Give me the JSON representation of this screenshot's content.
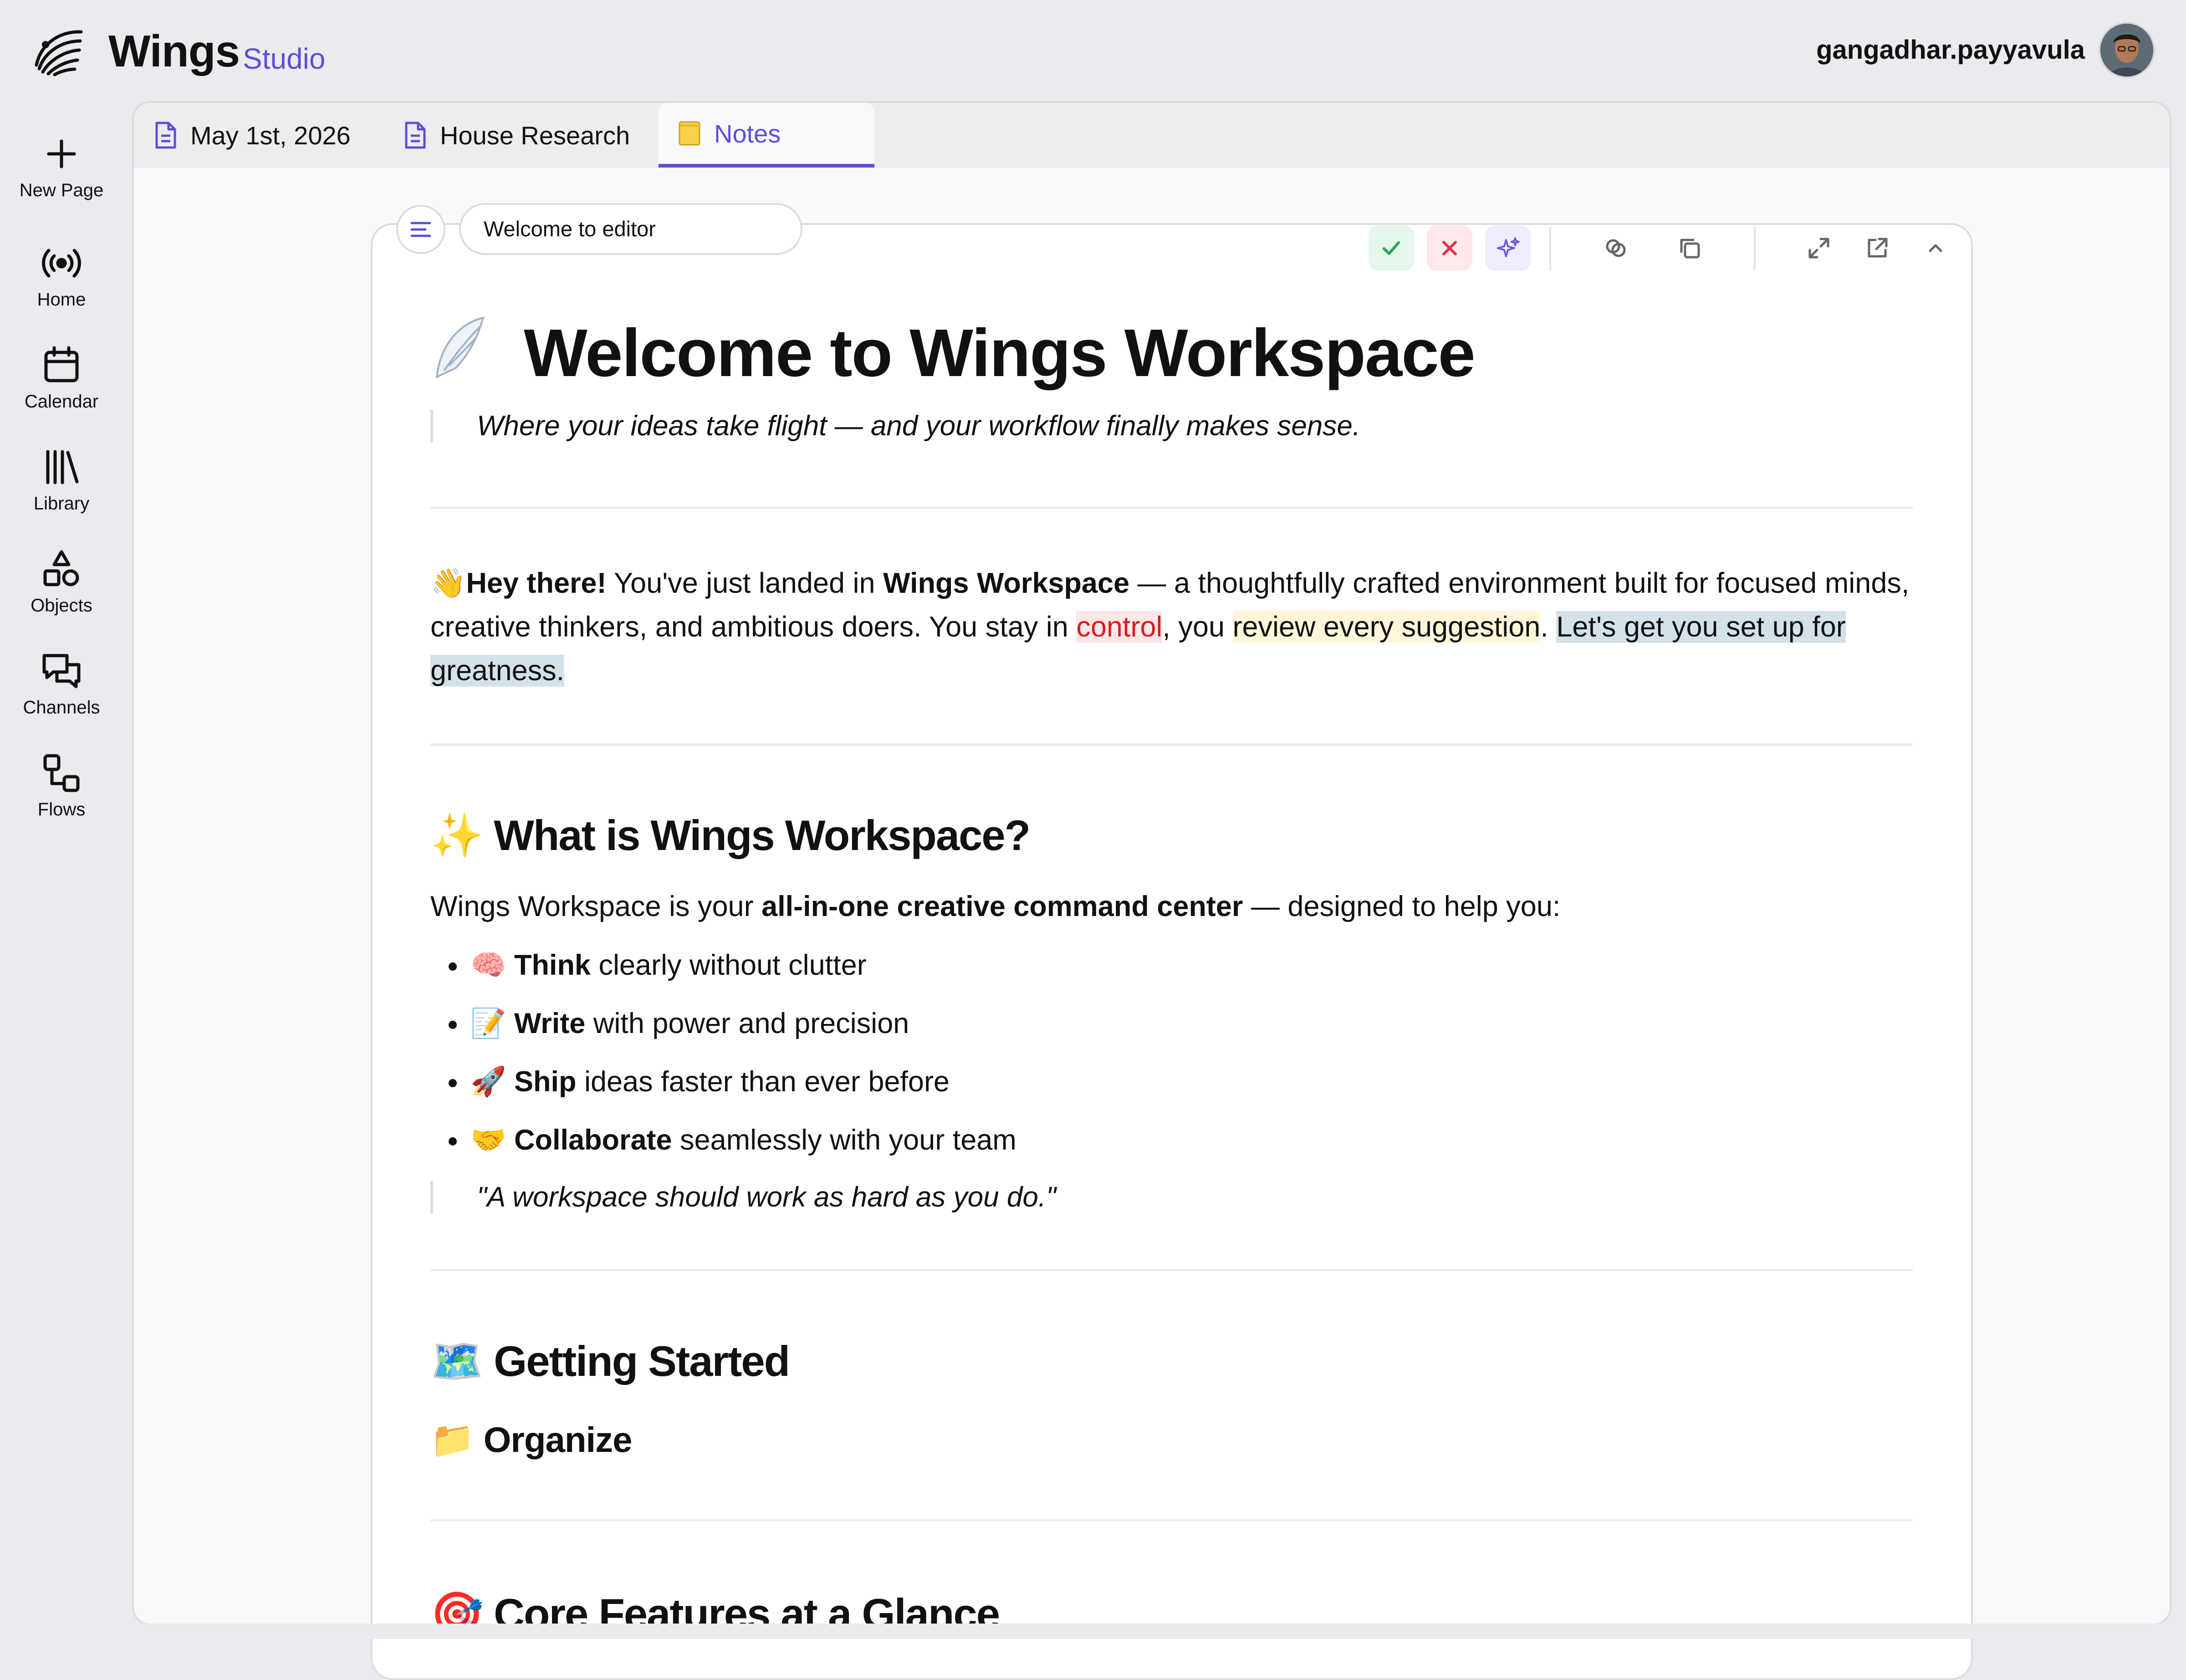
{
  "app": {
    "title": "Wings",
    "subtitle": "Studio"
  },
  "user": {
    "name": "gangadhar.payyavula"
  },
  "sidebar": {
    "items": [
      {
        "label": "New Page",
        "icon": "plus-icon"
      },
      {
        "label": "Home",
        "icon": "broadcast-icon"
      },
      {
        "label": "Calendar",
        "icon": "calendar-icon"
      },
      {
        "label": "Library",
        "icon": "library-icon"
      },
      {
        "label": "Objects",
        "icon": "shapes-icon"
      },
      {
        "label": "Channels",
        "icon": "chat-icon"
      },
      {
        "label": "Flows",
        "icon": "flow-icon"
      }
    ]
  },
  "tabs": [
    {
      "label": "May 1st, 2026",
      "icon": "document-icon"
    },
    {
      "label": "House Research",
      "icon": "document-icon"
    },
    {
      "label": "Notes",
      "icon": "notepad-emoji",
      "active": true
    }
  ],
  "editor": {
    "title_input": "Welcome to editor",
    "toolbar": [
      "accept-icon",
      "reject-icon",
      "ai-sparkle-icon",
      "link-icon",
      "copy-icon",
      "expand-icon",
      "open-external-icon",
      "collapse-icon"
    ]
  },
  "doc": {
    "title": "Welcome to Wings Workspace",
    "title_emoji": "🪽",
    "tagline": "Where your ideas take flight — and your workflow finally makes sense.",
    "intro": {
      "emoji": "👋",
      "bold1": "Hey there!",
      "t1": " You've just landed in ",
      "bold2": "Wings Workspace",
      "t2": " — a thoughtfully crafted environment built for focused minds, creative thinkers, and ambitious doers. You stay in ",
      "red": "control",
      "t3": ", you ",
      "yellow": "review every suggestion",
      "t4": ". ",
      "blue": "Let's get you set up for greatness."
    },
    "section1": {
      "emoji": "✨",
      "heading": "What is Wings Workspace?",
      "lead_t1": "Wings Workspace is your ",
      "lead_bold": "all-in-one creative command center",
      "lead_t2": " — designed to help you:",
      "bullets": [
        {
          "emoji": "🧠",
          "bold": "Think",
          "text": " clearly without clutter"
        },
        {
          "emoji": "📝",
          "bold": "Write",
          "text": " with power and precision"
        },
        {
          "emoji": "🚀",
          "bold": "Ship",
          "text": " ideas faster than ever before"
        },
        {
          "emoji": "🤝",
          "bold": "Collaborate",
          "text": " seamlessly with your team"
        }
      ],
      "quote": "\"A workspace should work as hard as you do.\""
    },
    "section2": {
      "emoji": "🗺️",
      "heading": "Getting Started",
      "sub_emoji": "📁",
      "sub": "Organize"
    },
    "section3": {
      "emoji": "🎯",
      "heading": "Core Features at a Glance"
    }
  }
}
